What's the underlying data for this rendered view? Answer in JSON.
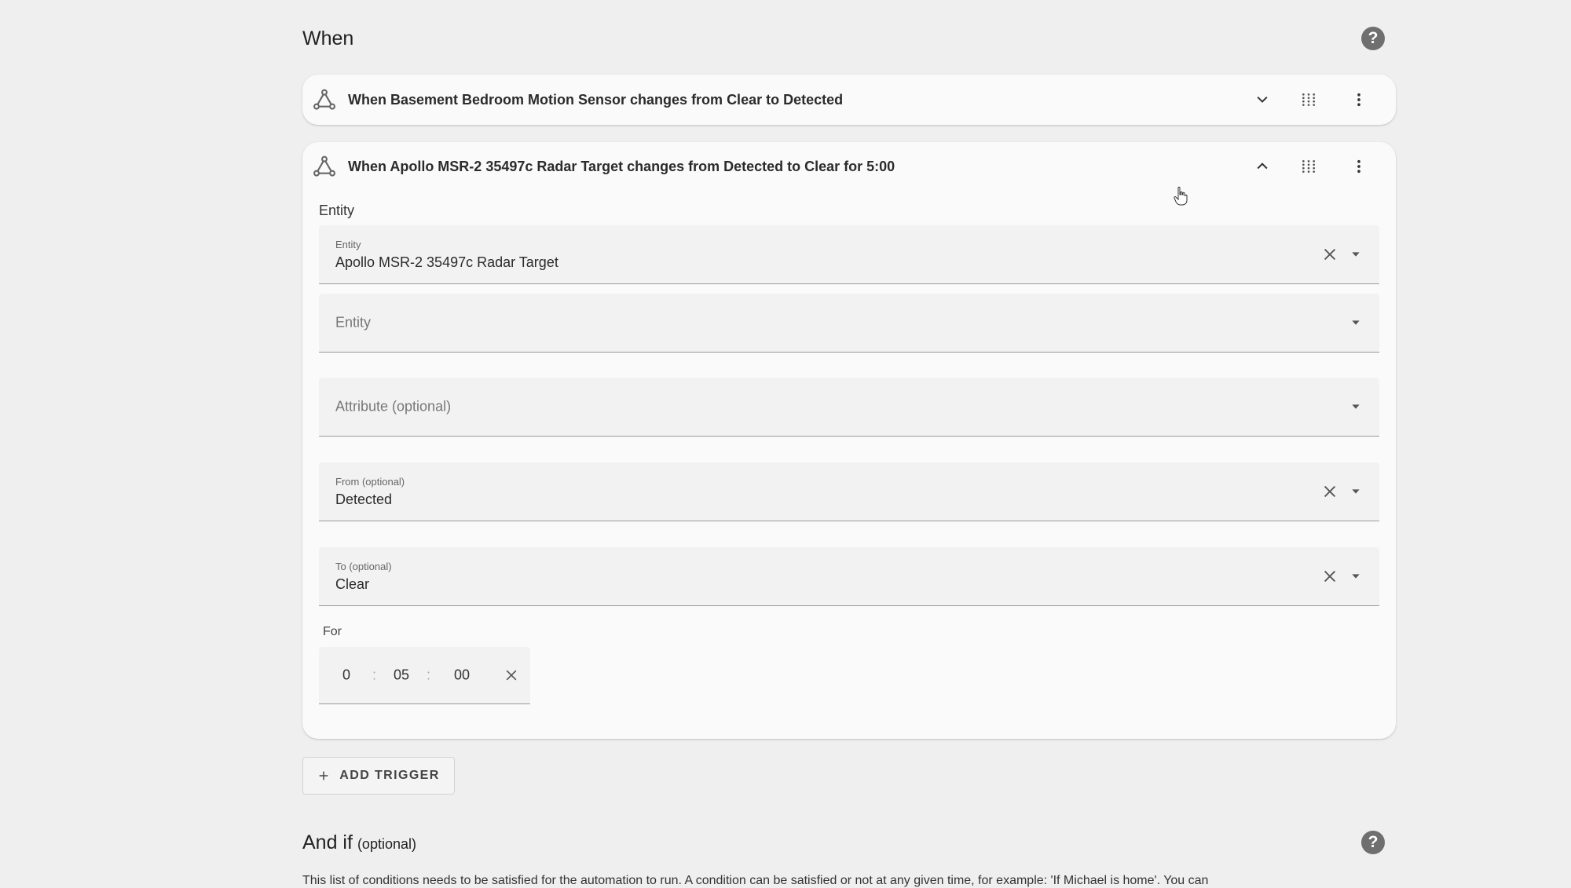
{
  "when_section": {
    "title": "When"
  },
  "triggers": [
    {
      "title": "When Basement Bedroom Motion Sensor changes from Clear to Detected",
      "expanded": false
    },
    {
      "title": "When Apollo MSR-2 35497c Radar Target changes from Detected to Clear for 5:00",
      "expanded": true,
      "entity_section_label": "Entity",
      "entity_field": {
        "label": "Entity",
        "value": "Apollo MSR-2 35497c Radar Target"
      },
      "entity_add_field": {
        "placeholder": "Entity"
      },
      "attribute_field": {
        "placeholder": "Attribute (optional)"
      },
      "from_field": {
        "label": "From (optional)",
        "value": "Detected"
      },
      "to_field": {
        "label": "To (optional)",
        "value": "Clear"
      },
      "for_label": "For",
      "duration": {
        "hours": "0",
        "minutes": "05",
        "seconds": "00",
        "separator": ":"
      }
    }
  ],
  "add_trigger_label": "ADD TRIGGER",
  "and_if_section": {
    "title": "And if",
    "optional_label": "(optional)",
    "description": "This list of conditions needs to be satisfied for the automation to run. A condition can be satisfied or not at any given time, for example: 'If Michael is home'. You can"
  },
  "icons": {
    "help": "help-circle-icon",
    "trigger": "state-trigger-icon",
    "expand": "chevron-down-icon",
    "collapse": "chevron-up-icon",
    "drag": "drag-handle-icon",
    "menu": "dots-vertical-icon",
    "clear": "close-icon",
    "dropdown": "menu-down-icon",
    "add": "plus-icon"
  },
  "colors": {
    "background": "#efefef",
    "card": "#fafafa",
    "field": "#f2f2f2",
    "icon": "#555555"
  }
}
